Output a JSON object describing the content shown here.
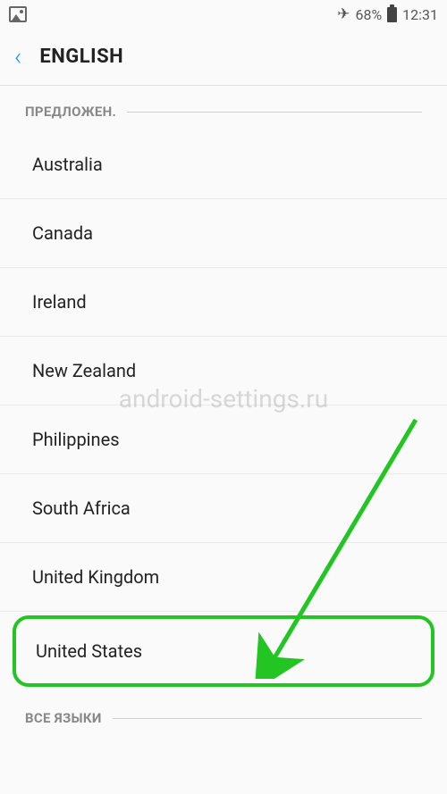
{
  "status_bar": {
    "battery_percent": "68%",
    "time": "12:31"
  },
  "app_bar": {
    "title": "ENGLISH"
  },
  "sections": {
    "suggested": {
      "title": "ПРЕДЛОЖЕН.",
      "items": [
        "Australia",
        "Canada",
        "Ireland",
        "New Zealand",
        "Philippines",
        "South Africa",
        "United Kingdom",
        "United States"
      ]
    },
    "all_languages": {
      "title": "ВСЕ ЯЗЫКИ"
    }
  },
  "watermark": "android-settings.ru",
  "annotation": {
    "arrow_color": "#22c522"
  }
}
